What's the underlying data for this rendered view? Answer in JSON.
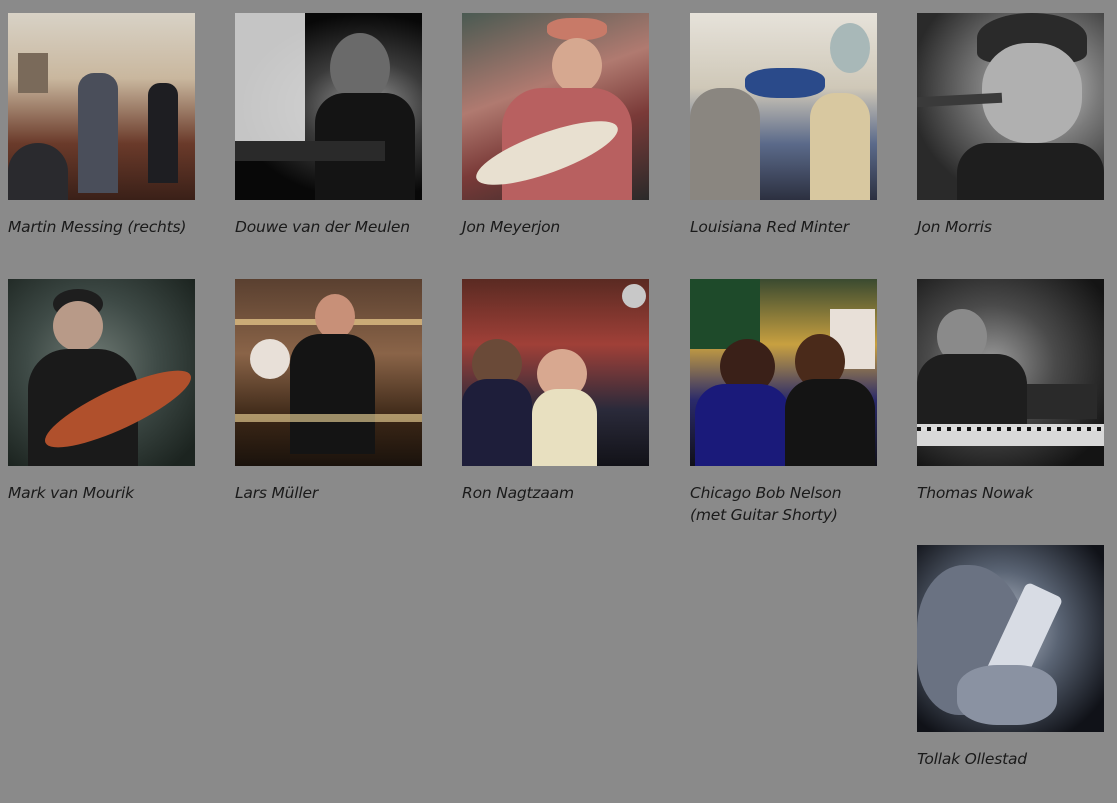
{
  "musicians": [
    {
      "name": "Martin Messing (rechts)"
    },
    {
      "name": "Douwe van der Meulen"
    },
    {
      "name": "Jon Meyerjon"
    },
    {
      "name": "Louisiana Red Minter"
    },
    {
      "name": "Jon Morris"
    },
    {
      "name": "Mark van Mourik"
    },
    {
      "name": "Lars Müller"
    },
    {
      "name": "Ron Nagtzaam"
    },
    {
      "name": "Chicago Bob Nelson (met Guitar Shorty)"
    },
    {
      "name": "Thomas Nowak"
    },
    {
      "name": "Tollak Ollestad"
    }
  ]
}
